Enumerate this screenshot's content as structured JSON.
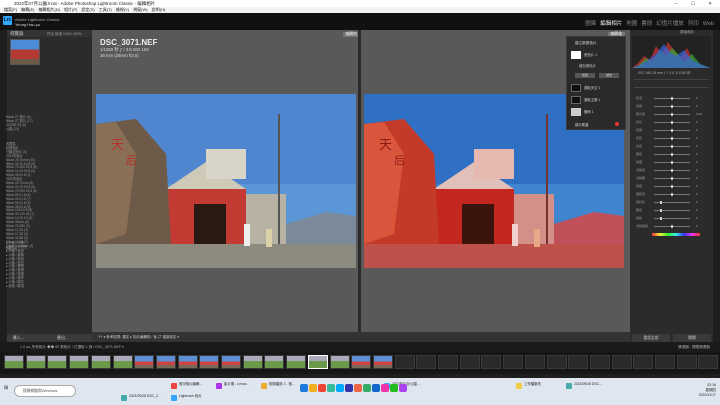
{
  "window": {
    "title": "2022年07月公園.lrcat - Adobe Photoshop Lightroom Classic - 編輯相片"
  },
  "menubar": {
    "items": [
      "檔案(F)",
      "編輯(E)",
      "編輯相片(D)",
      "相片(P)",
      "設定(S)",
      "工具(T)",
      "檢視(V)",
      "視窗(W)",
      "說明(H)"
    ]
  },
  "identity": {
    "line1": "Adobe Lightroom Classic",
    "line2": "Yeung Hau-yu"
  },
  "modules": {
    "items": [
      "圖庫",
      "編輯相片",
      "地圖",
      "書冊",
      "幻燈片播放",
      "列印",
      "Web"
    ],
    "active": "編輯相片"
  },
  "left_panel": {
    "navigator": "導覽器",
    "navigator_zoom": "符合  填滿  100%  400%",
    "tree1": [
      "  Nikon Z7 照片 (8)",
      "  Nikon Z7 照片 (17)",
      "  2022年7月 (8)",
      "  公園 (10)"
    ],
    "tree2": [
      "收藏集",
      "  精選相片",
      "  已鎖定照片 (0)",
      "2022年相片",
      "  Nikon 28-70mm (10)",
      "  Nikon 24-70 f/2.8 (5)",
      "  Nikon 70-200 f/2.8 (6)",
      "  Nikon 14-24 f/2.8 (4)",
      "  Nikon 35 f/1.8 (3)",
      "2022年相片",
      "  Nikon 28-70mm (8)",
      "  Nikon 24-70 f/2.8 (6)",
      "  Nikon 70-200 f/2.8 (8)",
      "  Nikon 85 f/1.8 (4)",
      "  Nikon 20 f/1.8 (7)",
      "  Nikon 50 f/1.8 (5)",
      "  Nikon 28 f/2.8 (5)",
      "  Nikon 105 f/2.8 (8)",
      "  Nikon 24-120 f/4 (7)",
      "  Nikon 14-30 f/4 (6)",
      "  Nikon 35mm (6)",
      "  Nikon 70-300 (3)",
      "  Nikon 12-24 (4)",
      "  Nikon 17-35 (6)",
      "  Nikon 24-85 (3)",
      "  Nikon 18-55 (2)",
      "  Nikon 60 Macro (4)",
      "  其他 (8)"
    ],
    "tree3": [
      "▸ 人像 / 人物",
      "▸ 風景 / 大自然",
      "▸ 人像 / 夜景",
      "▸ 人像 / 建築",
      "▸ 人像 / 街拍",
      "▸ 人像 / 花卉",
      "▸ 人像 / 食物",
      "▸ 人像 / 動物",
      "▸ 人像 / 旅遊",
      "▸ 人像 / 城市",
      "▸ 人像 / 廟宇",
      "▸ 其他 / 雜項"
    ],
    "import_btn": "匯入...",
    "export_btn": "匯出..."
  },
  "photo": {
    "filename": "DSC_3071.NEF",
    "exposure": "1/1250 秒    ƒ / 3.5    ISO 160",
    "lens": "28 mm (28mm f/3.5)",
    "before_label": "編輯前",
    "after_label": "編輯後"
  },
  "mask_panel": {
    "title": "建立新遮色片",
    "mask1": "遮色片 1",
    "mask1_sub": "增加遮色片",
    "btn_add": "增加",
    "btn_sub": "減去",
    "item1": "選取天空 1",
    "item2": "選取主體 1",
    "item3": "筆刷 1",
    "show_overlay": "顯示覆蓋"
  },
  "right_panel": {
    "title": "原始相片",
    "hist_info": "ISO 160    28 mm    ƒ / 3.5    1/1250 秒",
    "sliders": [
      "色溫",
      "色調",
      "曝光度",
      "對比",
      "亮部",
      "陰影",
      "白色",
      "黑色",
      "紋理",
      "清晰度",
      "去朦朧",
      "色相",
      "飽和度",
      "銳利化",
      "雜色",
      "波紋",
      "去除邊緣"
    ],
    "values": [
      "0",
      "0",
      "0.00",
      "0",
      "0",
      "0",
      "0",
      "0",
      "0",
      "0",
      "0",
      "0",
      "0",
      "0",
      "0",
      "0",
      "0"
    ],
    "knob_pos": [
      0.5,
      0.5,
      0.5,
      0.5,
      0.5,
      0.5,
      0.5,
      0.5,
      0.5,
      0.5,
      0.5,
      0.5,
      0.5,
      0.2,
      0.2,
      0.2,
      0.5
    ],
    "reset_all": "重設全部",
    "close": "關閉"
  },
  "toolbar": {
    "text": "YY  ▾    參考檢視: 選定    ▸  相片編輯前 / 後   ⇄   複製設定   ▾"
  },
  "filmstrip_header": {
    "text": "1  2  ◂  ▸    所有相片  ◆◆  83 張相片 / 已選取 1 張 / DSC_3071.NEF  ▾",
    "filter": "篩選器 :    關閉篩選器"
  },
  "taskbar": {
    "search": "搜尋網路和Windows",
    "tasks": [
      {
        "label": "2021/09/26 DSC_2...",
        "color": "#4aa"
      },
      {
        "label": "Lightroom 相片",
        "color": "#31a8ff"
      },
      {
        "label": "首次相片編輯...",
        "color": "#e44"
      },
      {
        "label": "影片樂 - Lenov...",
        "color": "#a3e"
      },
      {
        "label": "相簿建設 2 - 相...",
        "color": "#ea3"
      },
      {
        "label": "2022年07月公園...",
        "color": "#31a8ff"
      },
      {
        "label": "工作檔案夾",
        "color": "#ec4"
      },
      {
        "label": "2021/09/26 DSC...",
        "color": "#4aa"
      }
    ],
    "time": "02:16",
    "day": "星期四",
    "date": "2022/11/17"
  }
}
